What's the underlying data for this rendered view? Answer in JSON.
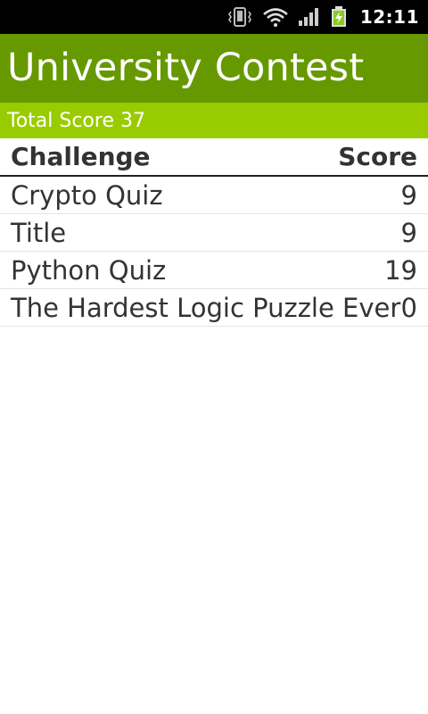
{
  "status_bar": {
    "time": "12:11",
    "icons": [
      "vibrate-icon",
      "wifi-icon",
      "signal-icon",
      "battery-charging-icon"
    ]
  },
  "app_bar": {
    "title": "University Contest",
    "color": "#669900"
  },
  "score_bar": {
    "text": "Total Score 37",
    "color": "#99cc00"
  },
  "table": {
    "headers": {
      "challenge": "Challenge",
      "score": "Score"
    },
    "rows": [
      {
        "challenge": "Crypto Quiz",
        "score": "9"
      },
      {
        "challenge": "Title",
        "score": "9"
      },
      {
        "challenge": "Python Quiz",
        "score": "19"
      },
      {
        "challenge": "The Hardest Logic Puzzle Ever",
        "score": "0"
      }
    ]
  }
}
